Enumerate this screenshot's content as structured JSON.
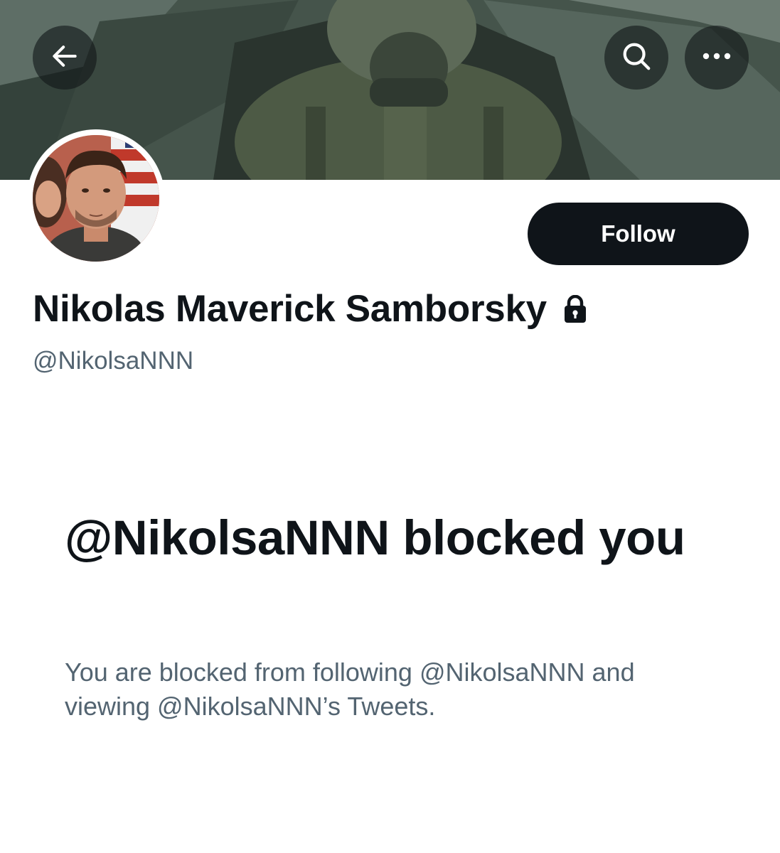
{
  "header": {
    "back_icon": "arrow-left-icon",
    "search_icon": "search-icon",
    "more_icon": "more-horizontal-icon"
  },
  "profile": {
    "display_name": "Nikolas Maverick Samborsky",
    "protected_icon": "lock-icon",
    "handle": "@NikolsaNNN",
    "follow_label": "Follow"
  },
  "blocked": {
    "title": "@NikolsaNNN blocked you",
    "description": "You are blocked from following @NikolsaNNN and viewing @NikolsaNNN’s Tweets."
  },
  "colors": {
    "primary_text": "#0f1419",
    "secondary_text": "#536471",
    "button_bg": "#0f1419",
    "button_text": "#ffffff"
  }
}
